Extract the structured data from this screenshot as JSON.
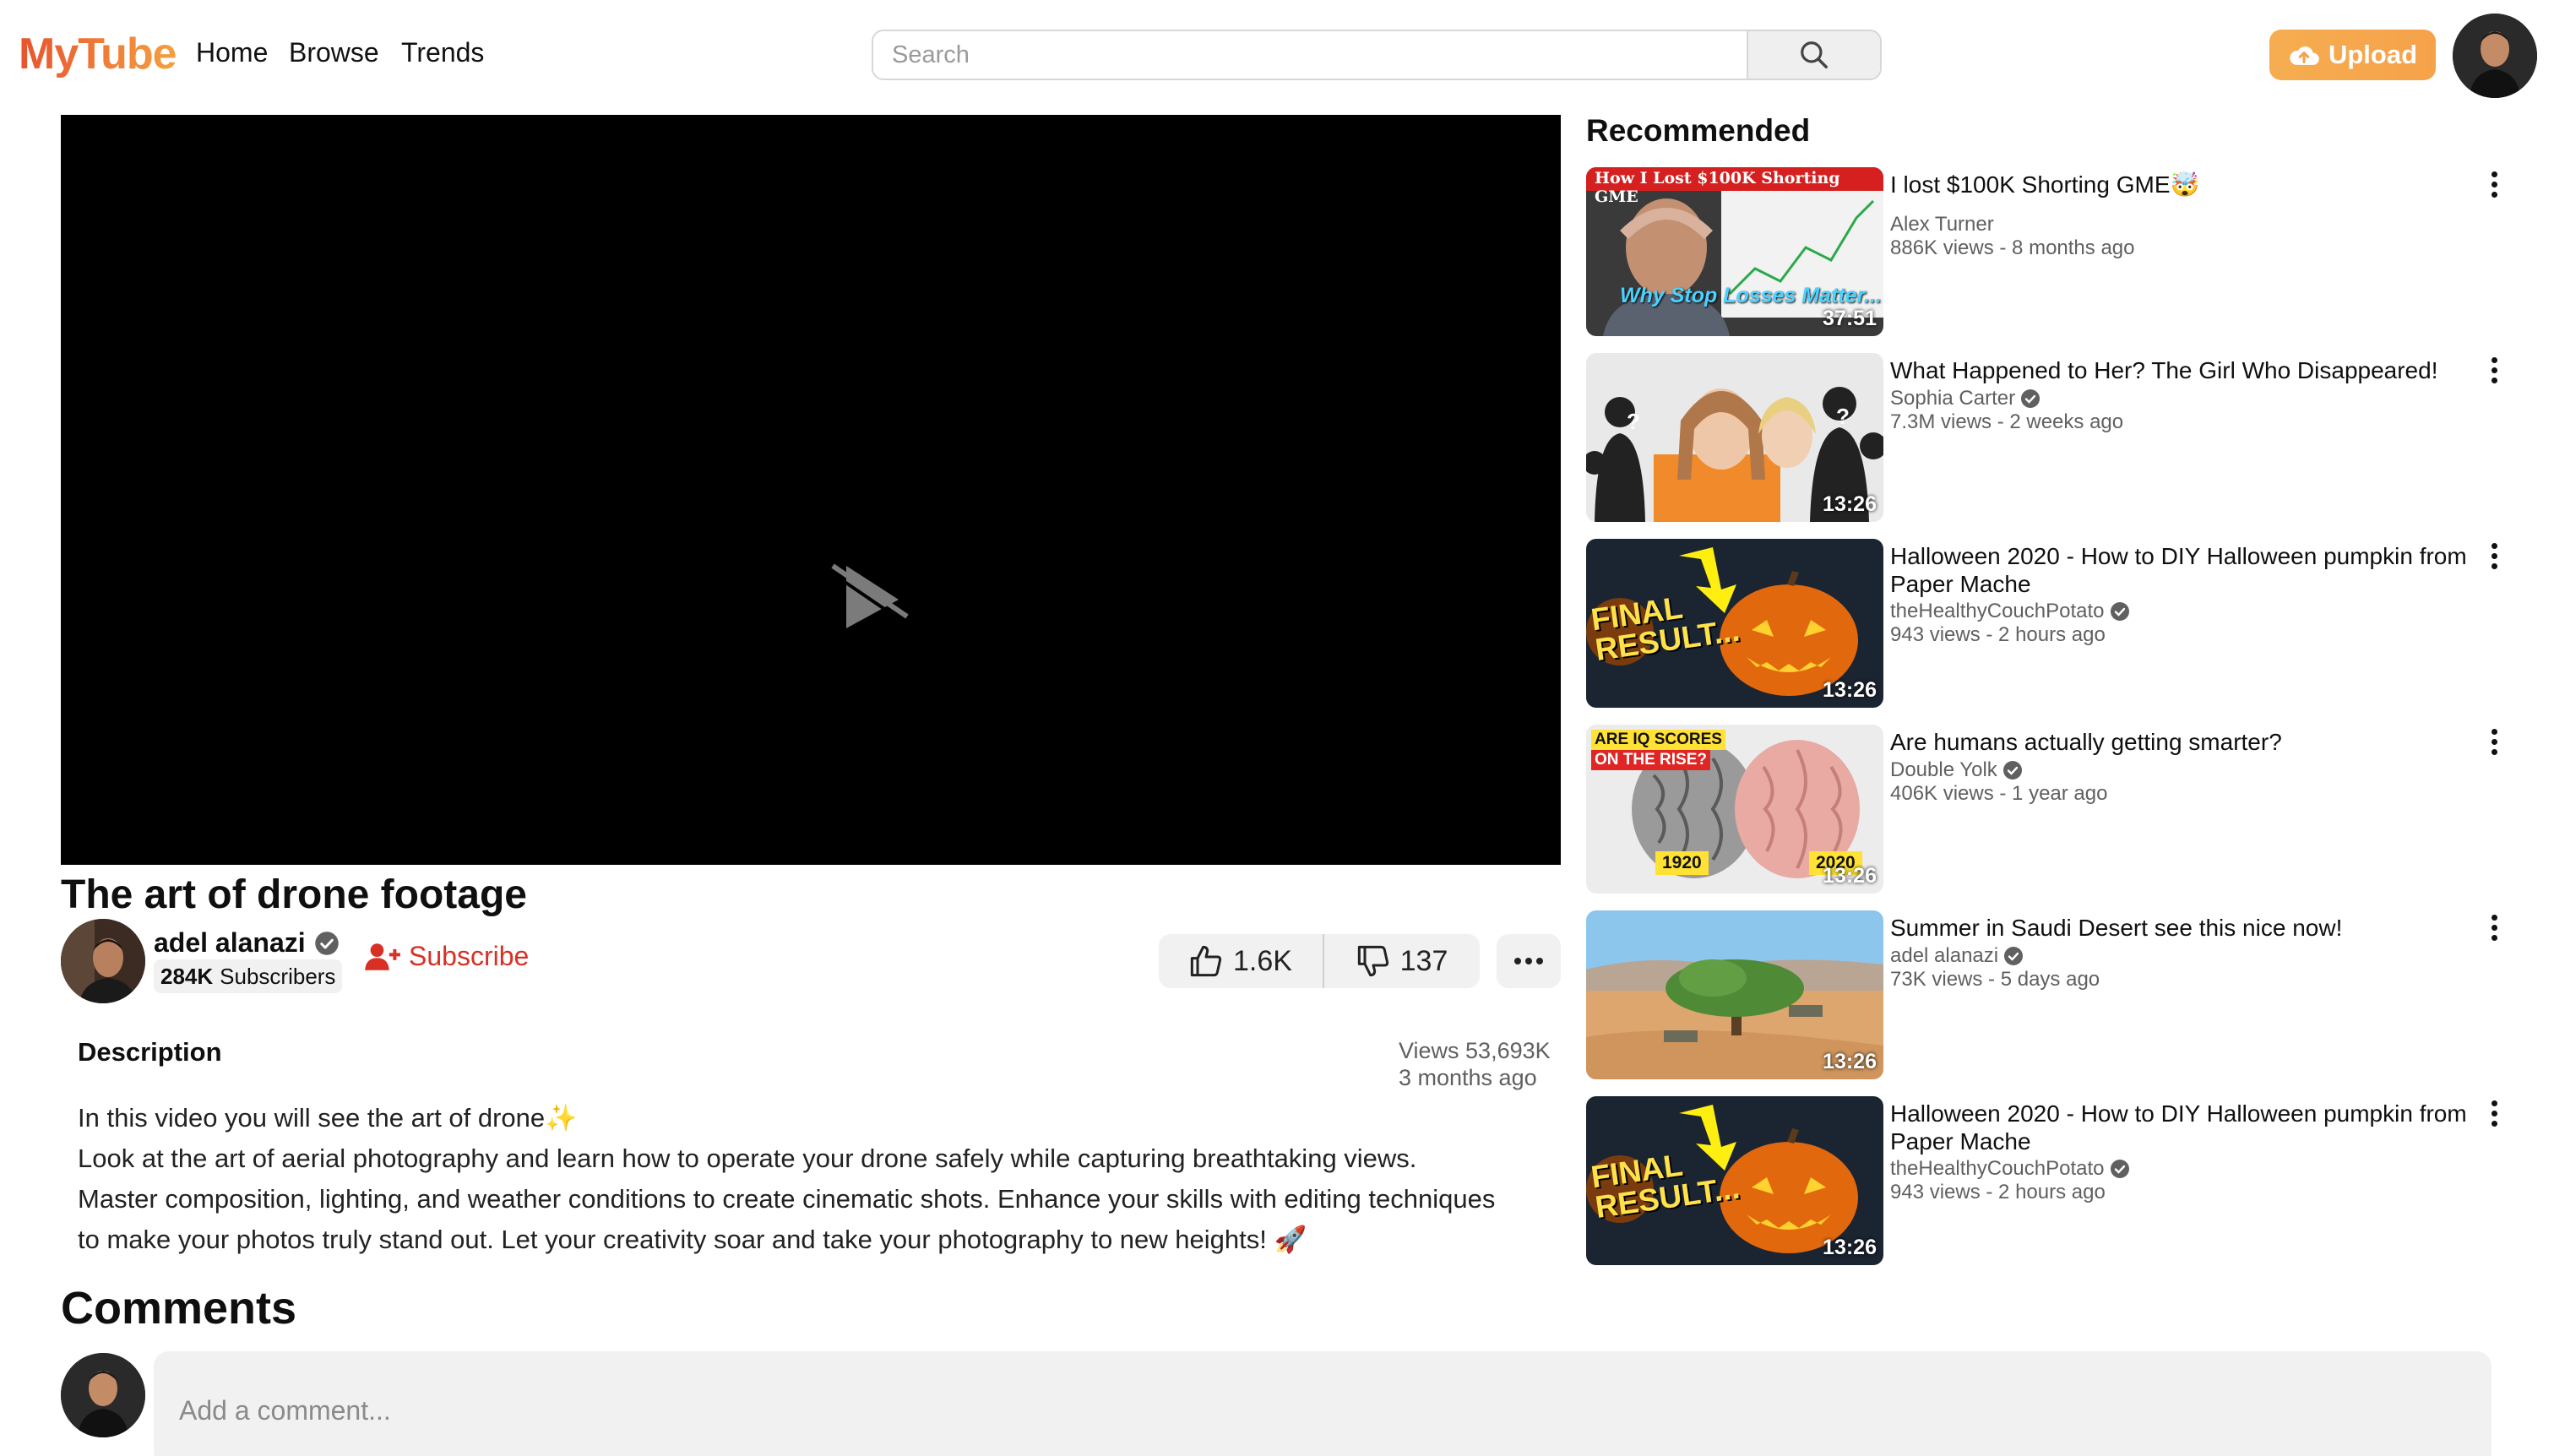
{
  "header": {
    "logo": "MyTube",
    "nav": [
      "Home",
      "Browse",
      "Trends"
    ],
    "search_placeholder": "Search",
    "upload_label": "Upload"
  },
  "video": {
    "title": "The art of drone footage",
    "channel_name": "adel alanazi",
    "subscribers_count": "284K",
    "subscribers_label": "Subscribers",
    "subscribe_label": "Subscribe",
    "likes": "1.6K",
    "dislikes": "137",
    "description_heading": "Description",
    "views": "Views 53,693K",
    "posted": "3 months ago",
    "description_lines": [
      "In this video you will see the art of drone✨",
      "Look at the art of aerial photography and learn how to operate your drone safely while capturing breathtaking views.",
      "Master composition, lighting, and weather conditions to create cinematic shots. Enhance your skills with editing techniques",
      "to make your photos truly stand out. Let your creativity soar and take your photography to new heights! 🚀"
    ]
  },
  "comments": {
    "heading": "Comments",
    "placeholder": "Add a comment..."
  },
  "recommended": {
    "heading": "Recommended",
    "items": [
      {
        "title": "I lost $100K Shorting GME🤯",
        "channel": "Alex Turner",
        "verified": false,
        "meta": "886K views - 8 months ago",
        "duration": "37:51",
        "thumb_text": "How I Lost $100K Shorting GME",
        "thumb_text_2": "Why Stop Losses Matter..."
      },
      {
        "title": "What Happened to Her? The Girl Who Disappeared!",
        "channel": "Sophia Carter",
        "verified": true,
        "meta": "7.3M views - 2 weeks ago",
        "duration": "13:26"
      },
      {
        "title": "Halloween 2020 - How to DIY Halloween pumpkin from Paper Mache",
        "channel": "theHealthyCouchPotato",
        "verified": true,
        "meta": "943 views - 2 hours ago",
        "duration": "13:26",
        "thumb_text": "FINAL RESULT..."
      },
      {
        "title": "Are humans actually getting smarter?",
        "channel": "Double Yolk",
        "verified": true,
        "meta": "406K views - 1 year ago",
        "duration": "13:26",
        "thumb_text": "ARE IQ SCORES",
        "thumb_text_2": "ON THE RISE?",
        "thumb_year_1": "1920",
        "thumb_year_2": "2020"
      },
      {
        "title": "Summer in Saudi Desert see this nice now!",
        "channel": "adel alanazi",
        "verified": true,
        "meta": "73K views - 5 days ago",
        "duration": "13:26"
      },
      {
        "title": "Halloween 2020 - How to DIY Halloween pumpkin from Paper Mache",
        "channel": "theHealthyCouchPotato",
        "verified": true,
        "meta": "943 views - 2 hours ago",
        "duration": "13:26",
        "thumb_text": "FINAL RESULT..."
      }
    ]
  },
  "colors": {
    "logo_gradient_start": "#e8532f",
    "logo_gradient_end": "#f4a040",
    "upload_button": "#f6ad50",
    "subscribe": "#d93025",
    "player_bg": "#000000"
  }
}
